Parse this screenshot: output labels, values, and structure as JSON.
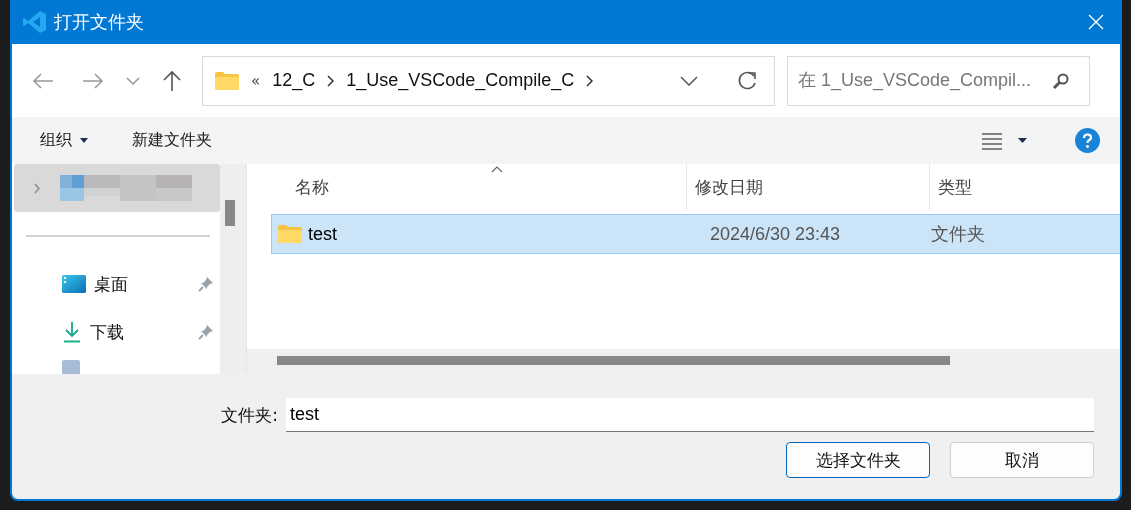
{
  "window": {
    "title": "打开文件夹"
  },
  "address": {
    "overflow": "«",
    "path": [
      "12_C",
      "1_Use_VSCode_Compile_C"
    ]
  },
  "search": {
    "placeholder": "在 1_Use_VSCode_Compil..."
  },
  "toolbar": {
    "organize": "组织",
    "new_folder": "新建文件夹"
  },
  "sidebar": {
    "items": [
      {
        "kind": "redacted",
        "selected": true
      },
      {
        "kind": "desktop",
        "label": "桌面",
        "pinned": true,
        "selected": false
      },
      {
        "kind": "download",
        "label": "下载",
        "pinned": true,
        "selected": false
      },
      {
        "kind": "documents",
        "selected": false
      }
    ]
  },
  "columns": [
    {
      "label": "名称",
      "sorted": true
    },
    {
      "label": "修改日期",
      "sorted": false
    },
    {
      "label": "类型",
      "sorted": false
    }
  ],
  "rows": [
    {
      "name": "test",
      "date": "2024/6/30 23:43",
      "type": "文件夹",
      "selected": true
    }
  ],
  "folder_field": {
    "label": "文件夹:",
    "value": "test"
  },
  "buttons": [
    {
      "label": "选择文件夹",
      "default": true
    },
    {
      "label": "取消",
      "default": false
    }
  ]
}
